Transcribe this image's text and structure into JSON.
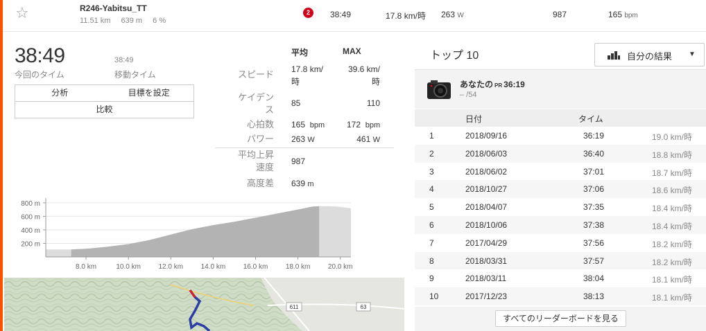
{
  "segment": {
    "name": "R246-Yabitsu_TT",
    "distance": "11.51 km",
    "elevation": "639 m",
    "grade": "6 %",
    "badge": "2",
    "time": "38:49",
    "speed": "17.8 km/時",
    "power": "263",
    "power_unit": "W",
    "vam": "987",
    "heartrate": "165",
    "heartrate_unit": "bpm"
  },
  "summary": {
    "elapsed_time": "38:49",
    "elapsed_label": "今回のタイム",
    "moving_time": "38:49",
    "moving_label": "移動タイム",
    "buttons": {
      "analysis": "分析",
      "set_goal": "目標を設定",
      "compare": "比較"
    }
  },
  "stats": {
    "avg_header": "平均",
    "max_header": "MAX",
    "speed_label": "スピード",
    "speed_avg": "17.8 km/",
    "speed_avg_unit": "時",
    "speed_max": "39.6 km/",
    "speed_max_unit": "時",
    "cadence_label_1": "ケイデン",
    "cadence_label_2": "ス",
    "cadence_avg": "85",
    "cadence_max": "110",
    "hr_label": "心拍数",
    "hr_avg": "165",
    "hr_avg_unit": "bpm",
    "hr_max": "172",
    "hr_max_unit": "bpm",
    "power_label": "パワー",
    "power_avg": "263",
    "power_avg_unit": "W",
    "power_max": "461",
    "power_max_unit": "W",
    "vam_label_1": "平均上昇",
    "vam_label_2": "速度",
    "vam_value": "987",
    "elev_label": "高度差",
    "elev_value": "639",
    "elev_unit": "m"
  },
  "chart_data": {
    "type": "area",
    "y_ticks": [
      "800 m",
      "600 m",
      "400 m",
      "200 m"
    ],
    "x_ticks": [
      "8.0 km",
      "10.0 km",
      "12.0 km",
      "14.0 km",
      "16.0 km",
      "18.0 km",
      "20.0 km"
    ],
    "xlim": [
      6.1,
      20.5
    ],
    "ylim": [
      0,
      850
    ],
    "x": [
      6.1,
      7.3,
      8.0,
      9.0,
      10.0,
      11.0,
      12.0,
      13.0,
      14.0,
      15.0,
      16.0,
      17.0,
      18.0,
      18.7,
      19.0,
      19.5,
      20.0,
      20.5
    ],
    "y": [
      110,
      110,
      120,
      150,
      190,
      250,
      330,
      410,
      470,
      520,
      580,
      640,
      700,
      745,
      750,
      750,
      740,
      720
    ],
    "segment_range": [
      7.3,
      19.0
    ]
  },
  "map": {
    "road_labels": [
      "63",
      "611"
    ]
  },
  "leaderboard": {
    "title": "トップ 10",
    "filter_label": "自分の結果",
    "my_label": "あなたの",
    "my_pr": "PR",
    "my_time": "36:19",
    "my_rank": "– /54",
    "col_date": "日付",
    "col_time": "タイム",
    "rows": [
      {
        "rank": "1",
        "date": "2018/09/16",
        "time": "36:19",
        "speed": "19.0 km/時"
      },
      {
        "rank": "2",
        "date": "2018/06/03",
        "time": "36:40",
        "speed": "18.8 km/時"
      },
      {
        "rank": "3",
        "date": "2018/06/02",
        "time": "37:01",
        "speed": "18.7 km/時"
      },
      {
        "rank": "4",
        "date": "2018/10/27",
        "time": "37:06",
        "speed": "18.6 km/時"
      },
      {
        "rank": "5",
        "date": "2018/04/07",
        "time": "37:35",
        "speed": "18.4 km/時"
      },
      {
        "rank": "6",
        "date": "2018/10/06",
        "time": "37:38",
        "speed": "18.4 km/時"
      },
      {
        "rank": "7",
        "date": "2017/04/29",
        "time": "37:56",
        "speed": "18.2 km/時"
      },
      {
        "rank": "8",
        "date": "2018/03/31",
        "time": "37:57",
        "speed": "18.2 km/時"
      },
      {
        "rank": "9",
        "date": "2018/03/11",
        "time": "38:04",
        "speed": "18.1 km/時"
      },
      {
        "rank": "10",
        "date": "2017/12/23",
        "time": "38:13",
        "speed": "18.1 km/時"
      }
    ],
    "view_all": "すべてのリーダーボードを見る"
  },
  "colors": {
    "accent": "#fc5200",
    "badge": "#d0021b",
    "route": "#2c3ea3",
    "route_start": "#e02020"
  }
}
